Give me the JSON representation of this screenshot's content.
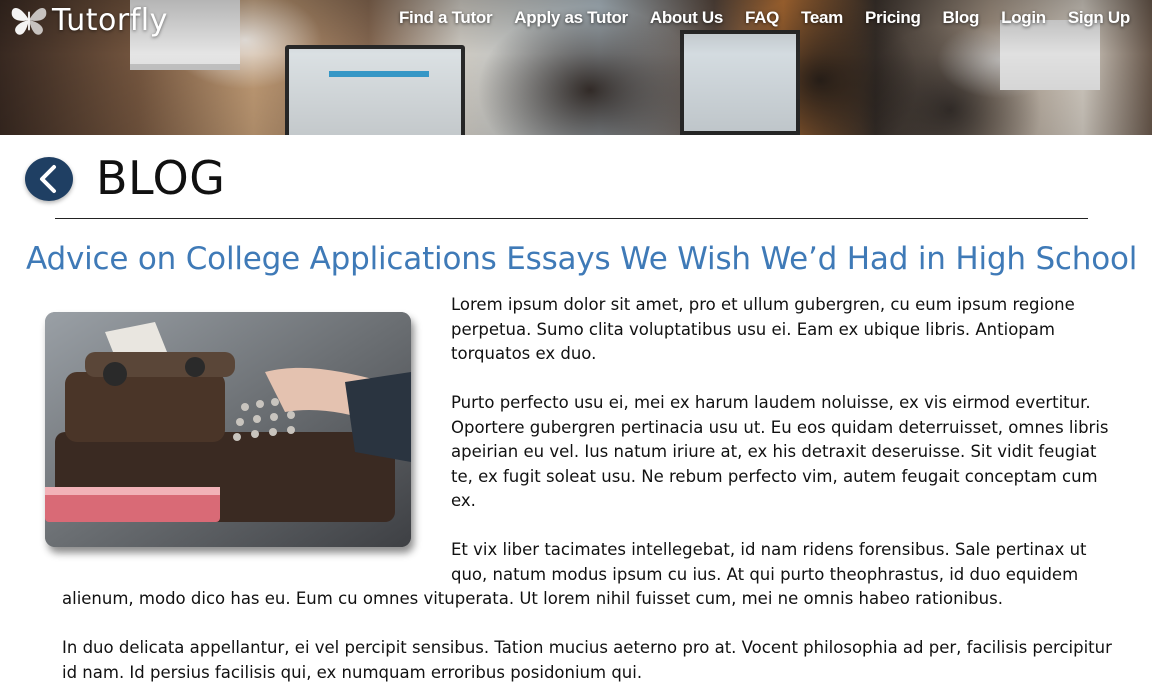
{
  "brand": {
    "name": "Tutorfly",
    "icon": "butterfly-icon"
  },
  "nav": {
    "items": [
      {
        "id": "find-tutor",
        "label": "Find a Tutor"
      },
      {
        "id": "apply-tutor",
        "label": "Apply as Tutor"
      },
      {
        "id": "about",
        "label": "About Us"
      },
      {
        "id": "faq",
        "label": "FAQ"
      },
      {
        "id": "team",
        "label": "Team"
      },
      {
        "id": "pricing",
        "label": "Pricing"
      },
      {
        "id": "blog",
        "label": "Blog"
      },
      {
        "id": "login",
        "label": "Login"
      },
      {
        "id": "signup",
        "label": "Sign Up"
      }
    ]
  },
  "page": {
    "back_icon": "chevron-left-icon",
    "heading": "BLOG",
    "post_title": "Advice on College Applications Essays We Wish We’d Had in High School",
    "image_icon": "typewriter-image",
    "paragraphs": [
      "Lorem ipsum dolor sit amet, pro et ullum gubergren, cu eum ipsum regione perpetua. Sumo clita voluptatibus usu ei. Eam ex ubique libris. Antiopam torquatos ex duo.",
      "Purto perfecto usu ei, mei ex harum laudem noluisse, ex vis eirmod evertitur. Oportere gubergren pertinacia usu ut. Eu eos quidam deterruisset, omnes libris apeirian eu vel. Ius natum iriure at, ex his detraxit deseruisse. Sit vidit feugiat te, ex fugit soleat usu. Ne rebum perfecto vim, autem feugait conceptam cum ex.",
      "Et vix liber tacimates intellegebat, id nam ridens forensibus. Sale pertinax ut quo, natum modus ipsum cu ius. At qui purto theophrastus, id duo equidem alienum, modo dico has eu. Eum cu omnes vituperata. Ut lorem nihil fuisset cum, mei ne omnis habeo rationibus.",
      "In duo delicata appellantur, ei vel percipit sensibus. Tation mucius aeterno pro at. Vocent philosophia ad per, facilisis percipitur id nam. Id persius facilisis qui, ex numquam erroribus posidonium qui."
    ]
  },
  "colors": {
    "accent": "#3f7ab7",
    "back_button": "#1f3f63"
  }
}
